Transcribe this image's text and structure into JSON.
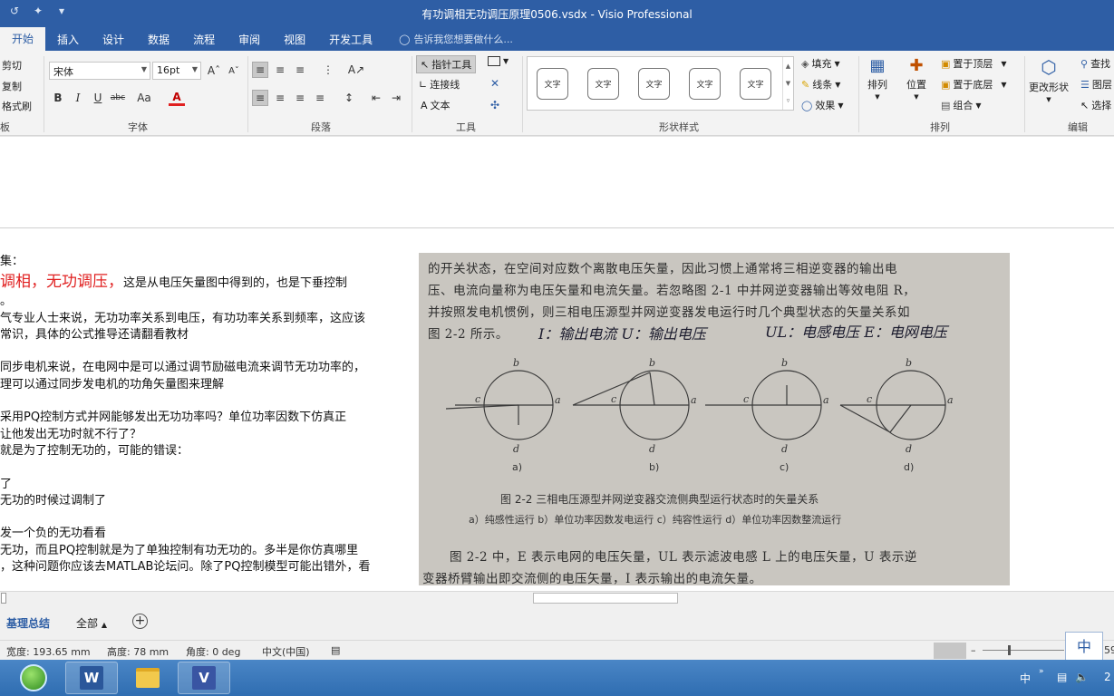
{
  "window": {
    "title": "有功调相无功调压原理0506.vsdx - Visio Professional"
  },
  "ribbon_tabs": [
    {
      "label": "开始",
      "active": true
    },
    {
      "label": "插入"
    },
    {
      "label": "设计"
    },
    {
      "label": "数据"
    },
    {
      "label": "流程"
    },
    {
      "label": "审阅"
    },
    {
      "label": "视图"
    },
    {
      "label": "开发工具"
    }
  ],
  "tell_me": "告诉我您想要做什么...",
  "clipboard": {
    "cut": "剪切",
    "copy": "复制",
    "format_painter": "格式刷",
    "group": "板"
  },
  "font": {
    "name": "宋体",
    "size": "16pt",
    "group": "字体",
    "bold": "B",
    "italic": "I",
    "underline": "U",
    "strike": "abc",
    "case": "Aa",
    "color": "A"
  },
  "paragraph": {
    "group": "段落"
  },
  "tools": {
    "pointer": "指针工具",
    "connector": "连接线",
    "text": "文本",
    "group": "工具"
  },
  "shape_styles": {
    "group": "形状样式",
    "boxes": [
      "文字",
      "文字",
      "文字",
      "文字",
      "文字"
    ],
    "fill": "填充",
    "line": "线条",
    "effect": "效果"
  },
  "arrange": {
    "group": "排列",
    "arrange": "排列",
    "position": "位置",
    "bring_front": "置于顶层",
    "send_back": "置于底层",
    "group_btn": "组合"
  },
  "edit": {
    "group": "编辑",
    "change_shape": "更改形状",
    "find": "查找",
    "layers": "图层",
    "select": "选择"
  },
  "notes": {
    "l1": "集：",
    "l2_big": "调相，无功调压，",
    "l2_rest": "这是从电压矢量图中得到的，也是下垂控制",
    "l3": "。",
    "l4": "气专业人士来说，无功功率关系到电压，有功功率关系到频率，这应该",
    "l5": "常识，具体的公式推导还请翻看教材",
    "l6": "",
    "l7": "同步电机来说，在电网中是可以通过调节励磁电流来调节无功功率的，",
    "l8": "理可以通过同步发电机的功角矢量图来理解",
    "l9": "",
    "l10": "采用PQ控制方式并网能够发出无功功率吗？单位功率因数下仿真正",
    "l11": "让他发出无功时就不行了？",
    "l12": "就是为了控制无功的，可能的错误：",
    "l13": "",
    "l14": "了",
    "l15": "无功的时候过调制了",
    "l16": "",
    "l17": "发一个负的无功看看",
    "l18": "无功，而且PQ控制就是为了单独控制有功无功的。多半是你仿真哪里",
    "l19": "，这种问题你应该去MATLAB论坛问。除了PQ控制模型可能出错外，看"
  },
  "photo": {
    "t1": "的开关状态，在空间对应数个离散电压矢量，因此习惯上通常将三相逆变器的输出电",
    "t2": "压、电流向量称为电压矢量和电流矢量。若忽略图 2-1 中并网逆变器输出等效电阻 R，",
    "t3": "并按照发电机惯例，则三相电压源型并网逆变器发电运行时几个典型状态的矢量关系如",
    "t4": "图 2-2 所示。",
    "hand1": "I：输出电流  U：输出电压",
    "hand2": "UL：电感电压  E：电网电压",
    "diagram_labels": [
      "a)",
      "b)",
      "c)",
      "d)"
    ],
    "caption": "图 2-2   三相电压源型并网逆变器交流侧典型运行状态时的矢量关系",
    "subcaption": "a）纯感性运行   b）单位功率因数发电运行   c）纯容性运行   d）单位功率因数整流运行",
    "b1": "图 2-2 中，E 表示电网的电压矢量，UL 表示滤波电感 L 上的电压矢量，U 表示逆",
    "b2": "变器桥臂输出即交流侧的电压矢量，I 表示输出的电流矢量。"
  },
  "page_tabs": {
    "active": "基理总结",
    "all": "全部",
    "add": "+"
  },
  "status": {
    "width": "宽度: 193.65 mm",
    "height": "高度: 78 mm",
    "angle": "角度: 0 deg",
    "lang": "中文(中国)",
    "zoom_tail": "59"
  },
  "ime": {
    "mode": "中"
  },
  "tray": {
    "ime": "中",
    "time": "2"
  },
  "colors": {
    "titlebar": "#2e5ea5",
    "accent_red": "#e02020",
    "taskbar": "#3a78bd"
  }
}
